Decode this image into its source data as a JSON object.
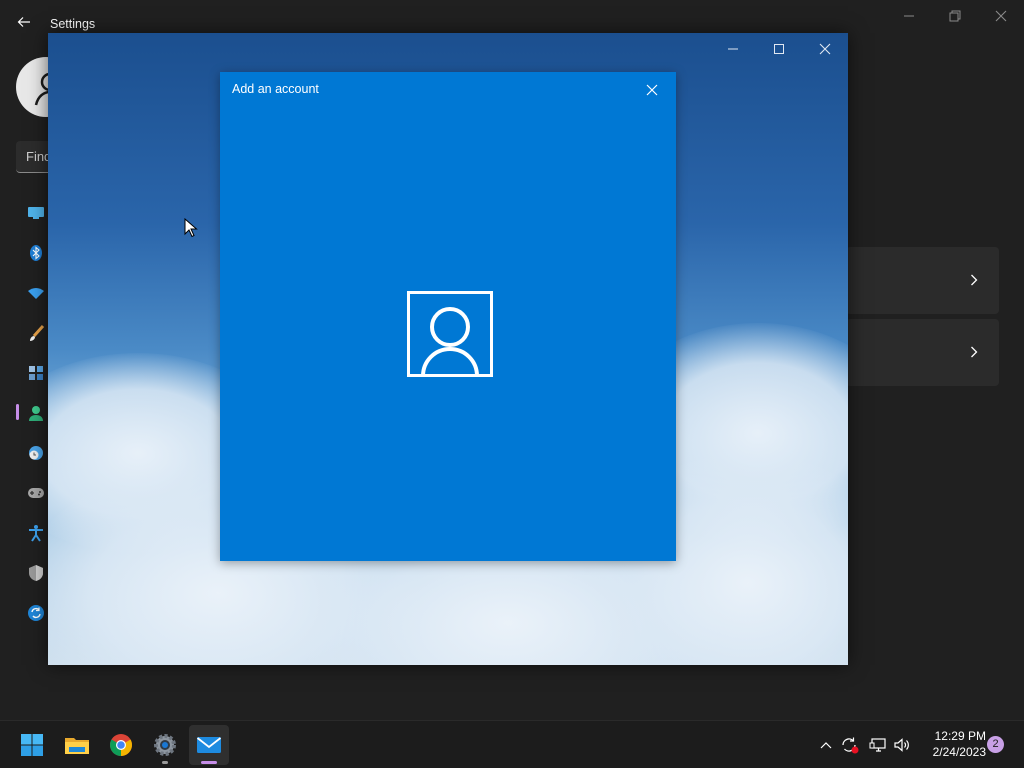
{
  "settings": {
    "title": "Settings",
    "search_placeholder": "Find",
    "nav_icons": [
      "system-icon",
      "bluetooth-icon",
      "network-icon",
      "personalization-icon",
      "apps-icon",
      "accounts-icon",
      "time-language-icon",
      "gaming-icon",
      "accessibility-icon",
      "privacy-icon",
      "windows-update-icon"
    ],
    "selected_nav": "accounts-icon"
  },
  "dialog": {
    "title": "Add an account",
    "glyph": "account-icon",
    "accent": "#0078d4"
  },
  "taskbar": {
    "apps": [
      "start-icon",
      "file-explorer-icon",
      "chrome-icon",
      "settings-icon",
      "mail-icon"
    ],
    "active_app": "mail-icon",
    "time": "12:29 PM",
    "date": "2/24/2023",
    "notification_count": "2"
  }
}
